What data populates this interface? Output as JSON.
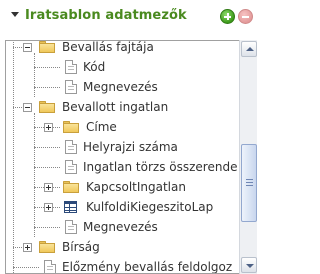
{
  "header": {
    "title": "Iratsablon adatmezők",
    "add_icon": "plus-circle-icon",
    "remove_icon": "minus-circle-icon",
    "colors": {
      "title": "#4a8a1f",
      "add": "#3d9a1a",
      "remove": "#e39a9a"
    }
  },
  "tree": {
    "items": [
      {
        "label": "Bevallás fajtája",
        "icon": "folder-icon",
        "expander": "collapse"
      },
      {
        "label": "Kód",
        "icon": "page-icon"
      },
      {
        "label": "Megnevezés",
        "icon": "page-icon"
      },
      {
        "label": "Bevallott ingatlan",
        "icon": "folder-icon",
        "expander": "collapse"
      },
      {
        "label": "Címe",
        "icon": "folder-icon",
        "expander": "expand"
      },
      {
        "label": "Helyrajzi száma",
        "icon": "page-icon"
      },
      {
        "label": "Ingatlan törzs összerende",
        "icon": "page-icon"
      },
      {
        "label": "KapcsoltIngatlan",
        "icon": "folder-icon",
        "expander": "expand"
      },
      {
        "label": "KulfoldiKiegeszitoLap",
        "icon": "form-icon",
        "expander": "expand"
      },
      {
        "label": "Megnevezés",
        "icon": "page-icon"
      },
      {
        "label": "Bírság",
        "icon": "folder-icon",
        "expander": "expand"
      },
      {
        "label": "Előzmény bevallás feldolgoz",
        "icon": "page-icon"
      }
    ]
  },
  "scrollbar": {
    "up_icon": "scroll-up-arrow-icon",
    "down_icon": "scroll-down-arrow-icon"
  }
}
